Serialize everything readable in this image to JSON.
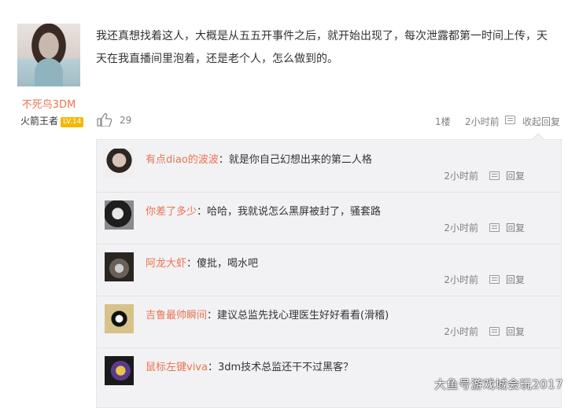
{
  "post": {
    "author": "不死鸟3DM",
    "title": "火箭王者",
    "level": "LV.14",
    "text": "我还真想找着这人，大概是从五五开事件之后，就开始出现了，每次泄露都第一时间上传，天天在我直播间里泡着，还是老个人，怎么做到的。",
    "likes": "29",
    "floor": "1楼",
    "time": "2小时前",
    "collapse_label": "收起回复"
  },
  "replies": [
    {
      "name": "有点diao的波波",
      "text": "就是你自己幻想出来的第二人格",
      "time": "2小时前",
      "reply_label": "回复"
    },
    {
      "name": "你差了多少",
      "text": "哈哈，我就说怎么黑屏被封了，骚套路",
      "time": "2小时前",
      "reply_label": "回复"
    },
    {
      "name": "阿龙大虾",
      "text": "傻批，喝水吧",
      "time": "2小时前",
      "reply_label": "回复"
    },
    {
      "name": "吉鲁最帅瞬间",
      "text": "建议总监先找心理医生好好看看(滑稽)",
      "time": "2小时前",
      "reply_label": "回复"
    },
    {
      "name": "鼠标左键viva",
      "text": "3dm技术总监还干不过黑客？",
      "time": "",
      "reply_label": ""
    }
  ],
  "watermark": "大鱼号游戏城会玩2017",
  "colors": {
    "username": "#eb7350",
    "reply_bg": "#f2f2f5",
    "level_badge": "#f5b700"
  },
  "icons": {
    "like": "thumbs-up-icon",
    "reply": "comment-icon"
  }
}
